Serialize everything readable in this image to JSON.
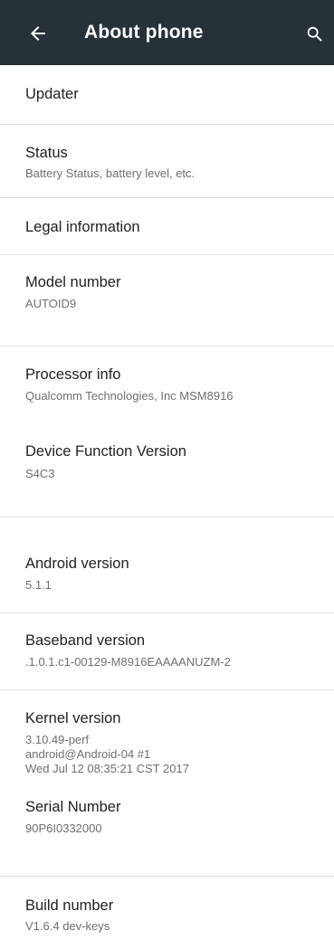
{
  "header": {
    "title": "About phone",
    "back_icon": "arrow-left-icon",
    "search_icon": "search-icon",
    "background": "#263238"
  },
  "items": [
    {
      "title": "Updater",
      "subtitle": ""
    },
    {
      "title": "Status",
      "subtitle": "Battery Status, battery level, etc."
    },
    {
      "title": "Legal information",
      "subtitle": ""
    },
    {
      "title": "Model number",
      "subtitle": "AUTOID9"
    },
    {
      "title": "Processor info",
      "subtitle": "Qualcomm Technologies, Inc MSM8916"
    },
    {
      "title": "Device Function Version",
      "subtitle": "S4C3"
    },
    {
      "title": "Android version",
      "subtitle": "5.1.1"
    },
    {
      "title": "Baseband version",
      "subtitle": ".1.0.1.c1-00129-M8916EAAAANUZM-2"
    },
    {
      "title": "Kernel version",
      "subtitle": "3.10.49-perf\nandroid@Android-04 #1\nWed Jul 12 08:35:21 CST 2017"
    },
    {
      "title": "Serial Number",
      "subtitle": "90P6I0332000"
    },
    {
      "title": "Build number",
      "subtitle": "V1.6.4 dev-keys"
    }
  ]
}
